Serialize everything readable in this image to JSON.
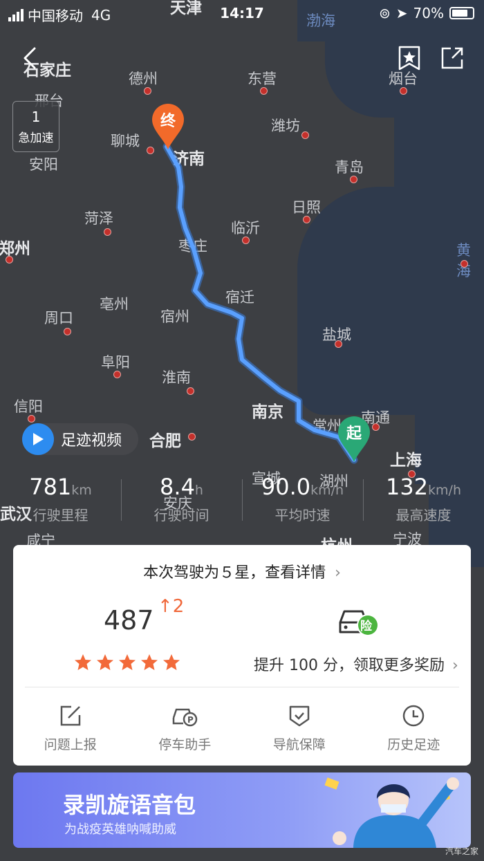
{
  "status_bar": {
    "carrier": "中国移动",
    "network": "4G",
    "time": "14:17",
    "battery": "70%",
    "battery_level": 0.7
  },
  "map": {
    "cities": [
      {
        "name": "天津",
        "big": true
      },
      {
        "name": "渤海",
        "sea": true
      },
      {
        "name": "石家庄",
        "big": true
      },
      {
        "name": "德州"
      },
      {
        "name": "东营"
      },
      {
        "name": "烟台"
      },
      {
        "name": "邢台"
      },
      {
        "name": "潍坊"
      },
      {
        "name": "聊城"
      },
      {
        "name": "济南",
        "big": true
      },
      {
        "name": "安阳"
      },
      {
        "name": "青岛"
      },
      {
        "name": "菏泽"
      },
      {
        "name": "日照"
      },
      {
        "name": "临沂"
      },
      {
        "name": "郑州",
        "big": true
      },
      {
        "name": "黄海",
        "sea": true
      },
      {
        "name": "枣庄"
      },
      {
        "name": "亳州"
      },
      {
        "name": "宿迁"
      },
      {
        "name": "周口"
      },
      {
        "name": "宿州"
      },
      {
        "name": "盐城"
      },
      {
        "name": "阜阳"
      },
      {
        "name": "淮南"
      },
      {
        "name": "信阳"
      },
      {
        "name": "南京",
        "big": true
      },
      {
        "name": "南通"
      },
      {
        "name": "常州"
      },
      {
        "name": "合肥",
        "big": true
      },
      {
        "name": "上海",
        "big": true
      },
      {
        "name": "宣城"
      },
      {
        "name": "湖州"
      },
      {
        "name": "武汉",
        "big": true
      },
      {
        "name": "安庆"
      },
      {
        "name": "咸宁"
      },
      {
        "name": "杭州",
        "big": true
      },
      {
        "name": "宁波"
      }
    ],
    "start_marker": "起",
    "end_marker": "终"
  },
  "accel_badge": {
    "count": "1",
    "label": "急加速"
  },
  "video_button": {
    "label": "足迹视频"
  },
  "stats": [
    {
      "value": "781",
      "unit": "km",
      "label": "行驶里程"
    },
    {
      "value": "8.4",
      "unit": "h",
      "label": "行驶时间"
    },
    {
      "value": "90.0",
      "unit": "km/h",
      "label": "平均时速"
    },
    {
      "value": "132",
      "unit": "km/h",
      "label": "最高速度"
    }
  ],
  "card": {
    "head": "本次驾驶为５星，查看详情",
    "score": "487",
    "delta": "2",
    "stars": 5,
    "insurance_badge": "险",
    "promo": "提升 100 分，领取更多奖励",
    "tools": [
      {
        "label": "问题上报",
        "icon": "edit-icon"
      },
      {
        "label": "停车助手",
        "icon": "parking-car-icon"
      },
      {
        "label": "导航保障",
        "icon": "shield-check-icon"
      },
      {
        "label": "历史足迹",
        "icon": "clock-icon"
      }
    ]
  },
  "banner": {
    "title": "录凯旋语音包",
    "subtitle": "为战疫英雄呐喊助威"
  },
  "watermark": "汽车之家",
  "colors": {
    "route": "#4a90f0",
    "start": "#2aa876",
    "end": "#f26a2a",
    "accent_orange": "#f0683a",
    "star": "#f26a3a"
  }
}
